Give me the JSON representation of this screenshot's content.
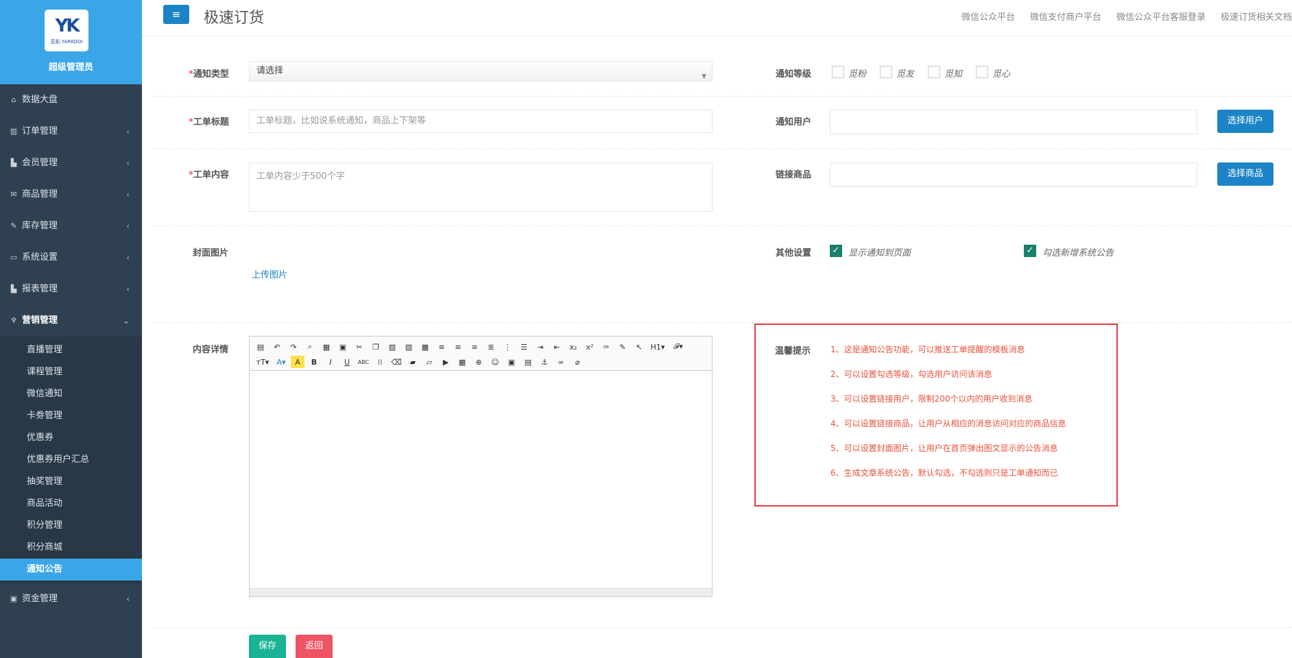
{
  "sidebar": {
    "brand_mark": "YK",
    "brand_sub": "亚凯.YARKOOI",
    "role": "超级管理员",
    "items": [
      {
        "icon": "home-icon",
        "glyph": "⌂",
        "label": "数据大盘"
      },
      {
        "icon": "columns-icon",
        "glyph": "▥",
        "label": "订单管理"
      },
      {
        "icon": "bar-chart-icon",
        "glyph": "▙",
        "label": "会员管理"
      },
      {
        "icon": "envelope-icon",
        "glyph": "✉",
        "label": "商品管理"
      },
      {
        "icon": "edit-icon",
        "glyph": "✎",
        "label": "库存管理"
      },
      {
        "icon": "desktop-icon",
        "glyph": "▭",
        "label": "系统设置"
      },
      {
        "icon": "bar-chart-icon",
        "glyph": "▙",
        "label": "报表管理"
      }
    ],
    "active_group": {
      "icon": "cutlery-icon",
      "glyph": "♆",
      "label": "营销管理"
    },
    "subitems": [
      "直播管理",
      "课程管理",
      "微信通知",
      "卡劵管理",
      "优惠券",
      "优惠券用户汇总",
      "抽奖管理",
      "商品活动",
      "积分管理",
      "积分商城",
      "通知公告"
    ],
    "active_sub_index": 10,
    "bottom_item": {
      "icon": "money-icon",
      "glyph": "▣",
      "label": "资金管理"
    }
  },
  "header": {
    "menu_glyph": "≡",
    "title": "极速订货",
    "links": [
      "微信公众平台",
      "微信支付商户平台",
      "微信公众平台客服登录",
      "极速订货相关文档"
    ]
  },
  "form": {
    "notice_type": {
      "label": "通知类型",
      "value": "请选择"
    },
    "notice_level": {
      "label": "通知等级",
      "options": [
        "觅粉",
        "觅友",
        "觅知",
        "觅心"
      ]
    },
    "ticket_title": {
      "label": "工单标题",
      "placeholder": "工单标题，比如说系统通知，商品上下架等"
    },
    "notice_users": {
      "label": "通知用户",
      "button": "选择用户"
    },
    "ticket_content": {
      "label": "工单内容",
      "placeholder": "工单内容少于500个字"
    },
    "linked_product": {
      "label": "链接商品",
      "button": "选择商品"
    },
    "cover": {
      "label": "封面图片",
      "upload": "上传图片"
    },
    "other": {
      "label": "其他设置",
      "options": [
        "显示通知到页面",
        "勾选新增系统公告"
      ]
    },
    "detail": {
      "label": "内容详情"
    }
  },
  "tips": {
    "label": "温馨提示",
    "lines": [
      "1、这是通知公告功能，可以推送工单提醒的模板消息",
      "2、可以设置勾选等级，勾选用户访问该消息",
      "3、可以设置链接用户，限制200个以内的用户收到消息",
      "4、可以设置链接商品，让用户从相应的消息访问对应的商品信息",
      "5、可以设置封面图片，让用户在首页弹出图文显示的公告消息",
      "6、生成文章系统公告，默认勾选，不勾选则只是工单通知而已"
    ]
  },
  "actions": {
    "save": "保存",
    "back": "返回"
  },
  "colors": {
    "sidebar": "#2f4050",
    "accent": "#3aa6e8",
    "primary": "#1c84c6",
    "save": "#1ab394",
    "back": "#ed5565",
    "tips_border": "#e83c3c"
  }
}
